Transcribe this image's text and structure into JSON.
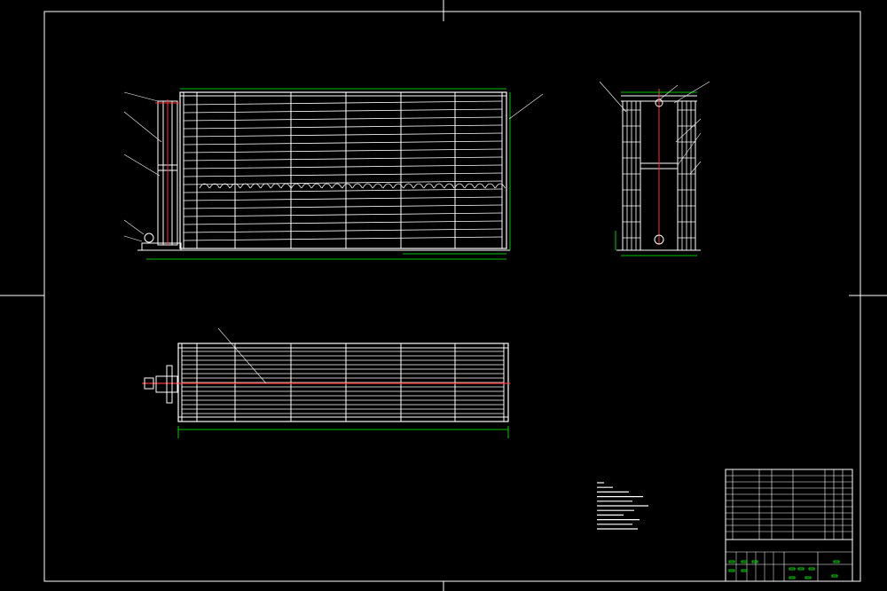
{
  "drawing": {
    "background": "#000000",
    "line_color": "#ffffff",
    "dimension_color": "#00ff00",
    "axis_color": "#ff3030",
    "views": [
      {
        "name": "front-elevation"
      },
      {
        "name": "side-elevation"
      },
      {
        "name": "plan-view"
      }
    ],
    "notes_block": {
      "line_count": 11
    },
    "title_block": {
      "rows": 10
    }
  }
}
